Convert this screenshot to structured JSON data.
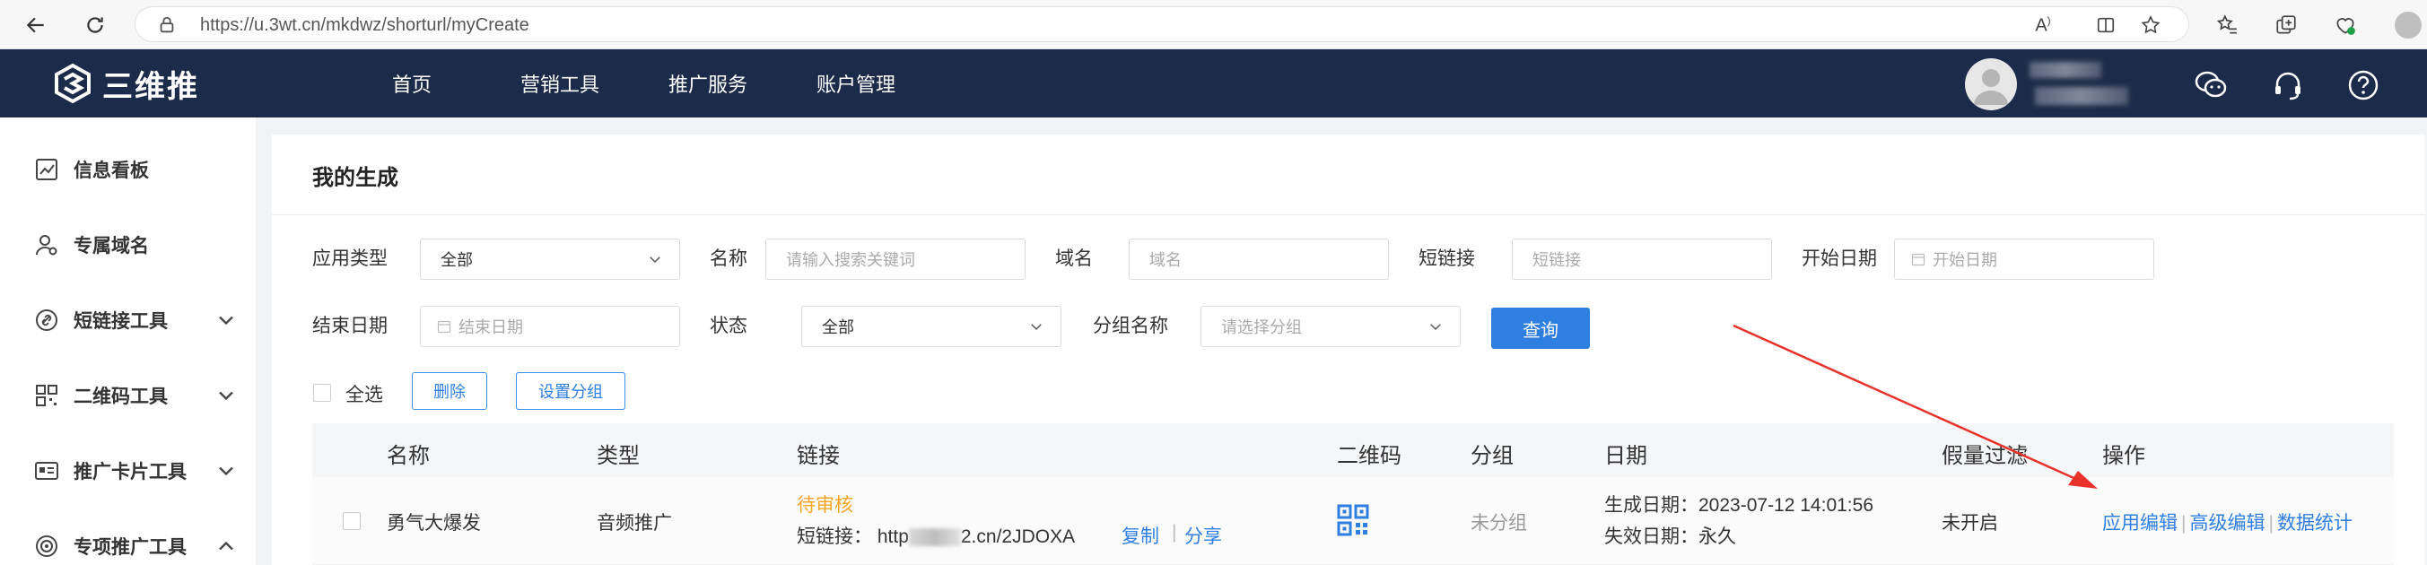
{
  "browser": {
    "url": "https://u.3wt.cn/mkdwz/shorturl/myCreate",
    "url_host": "https://u.3wt.cn",
    "url_path": "/mkdwz/shorturl/myCreate"
  },
  "header": {
    "logo_text": "三维推",
    "nav": [
      "首页",
      "营销工具",
      "推广服务",
      "账户管理"
    ],
    "icons": [
      "wechat-icon",
      "headset-icon",
      "help-icon"
    ]
  },
  "sidebar": {
    "items": [
      {
        "label": "信息看板",
        "icon": "chart-icon",
        "expandable": false
      },
      {
        "label": "专属域名",
        "icon": "user-settings-icon",
        "expandable": false
      },
      {
        "label": "短链接工具",
        "icon": "link-icon",
        "expandable": true,
        "expanded": false
      },
      {
        "label": "二维码工具",
        "icon": "qrcode-icon",
        "expandable": true,
        "expanded": false
      },
      {
        "label": "推广卡片工具",
        "icon": "card-icon",
        "expandable": true,
        "expanded": false
      },
      {
        "label": "专项推广工具",
        "icon": "target-icon",
        "expandable": true,
        "expanded": true
      }
    ]
  },
  "page": {
    "title": "我的生成"
  },
  "filters": {
    "app_type_label": "应用类型",
    "app_type_value": "全部",
    "name_label": "名称",
    "name_placeholder": "请输入搜索关键词",
    "domain_label": "域名",
    "domain_placeholder": "域名",
    "short_link_label": "短链接",
    "short_link_placeholder": "短链接",
    "start_date_label": "开始日期",
    "start_date_placeholder": "开始日期",
    "end_date_label": "结束日期",
    "end_date_placeholder": "结束日期",
    "status_label": "状态",
    "status_value": "全部",
    "group_label": "分组名称",
    "group_placeholder": "请选择分组",
    "query_button": "查询"
  },
  "bulk": {
    "select_all": "全选",
    "delete": "删除",
    "set_group": "设置分组"
  },
  "table": {
    "columns": [
      "名称",
      "类型",
      "链接",
      "二维码",
      "分组",
      "日期",
      "假量过滤",
      "操作"
    ],
    "rows": [
      {
        "name": "勇气大爆发",
        "type": "音频推广",
        "status": "待审核",
        "short_link_label": "短链接：",
        "short_link_prefix": "http",
        "short_link_suffix": "2.cn/2JDOXA",
        "copy": "复制",
        "share": "分享",
        "group": "未分组",
        "created_label": "生成日期：",
        "created": "2023-07-12 14:01:56",
        "expire_label": "失效日期：",
        "expire": "永久",
        "fake_filter": "未开启",
        "actions": [
          "应用编辑",
          "高级编辑",
          "数据统计"
        ]
      }
    ]
  },
  "colors": {
    "header_bg": "#1d2b4a",
    "accent": "#2f7fe0",
    "pending": "#f5a623",
    "annotation": "#e8322b"
  }
}
